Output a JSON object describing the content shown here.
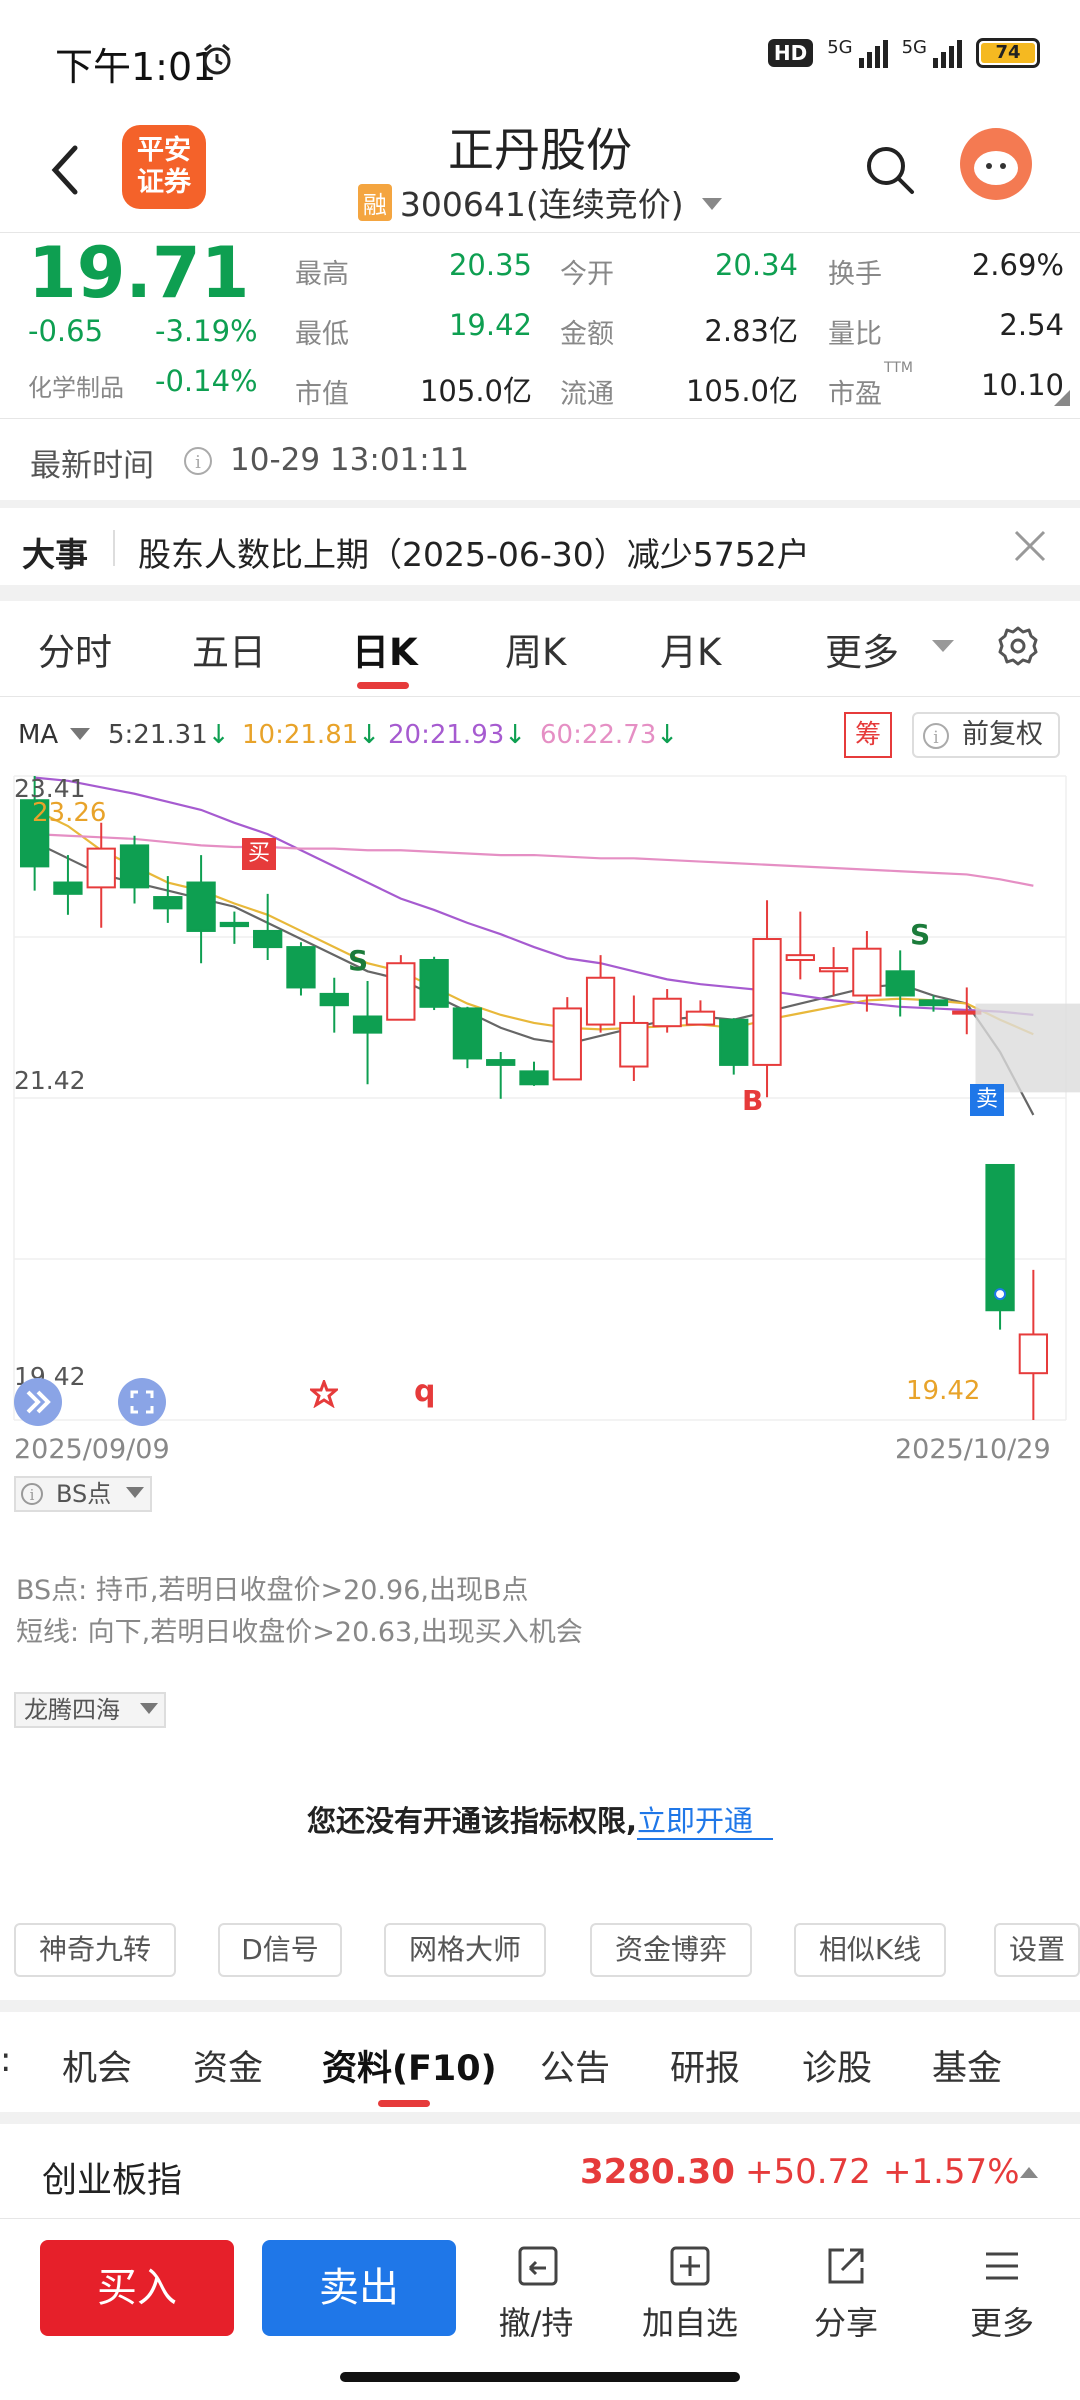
{
  "status_bar": {
    "time": "下午1:01",
    "hd": "HD",
    "net1": "5G",
    "net2": "5G",
    "battery": "74"
  },
  "header": {
    "app_logo": "平安\n证券",
    "stock_name": "正丹股份",
    "margin_badge": "融",
    "stock_code": "300641",
    "trade_mode": "(连续竞价)"
  },
  "quote": {
    "price": "19.71",
    "change": "-0.65",
    "change_pct": "-3.19%",
    "sector_label": "化学制品",
    "sector_pct": "-0.14%",
    "high_label": "最高",
    "high": "20.35",
    "open_label": "今开",
    "open": "20.34",
    "turnover_label": "换手",
    "turnover": "2.69%",
    "low_label": "最低",
    "low": "19.42",
    "amount_label": "金额",
    "amount": "2.83亿",
    "vol_ratio_label": "量比",
    "vol_ratio": "2.54",
    "mcap_label": "市值",
    "mcap": "105.0亿",
    "float_label": "流通",
    "float": "105.0亿",
    "pe_label": "市盈",
    "pe_ttm": "TTM",
    "pe": "10.10"
  },
  "update": {
    "label": "最新时间",
    "time": "10-29 13:01:11"
  },
  "event": {
    "tag": "大事",
    "text": "股东人数比上期（2025-06-30）减少5752户"
  },
  "period_tabs": [
    "分时",
    "五日",
    "日K",
    "周K",
    "月K",
    "更多"
  ],
  "active_tab": "日K",
  "ma": {
    "label": "MA",
    "ma5": "5:21.31",
    "ma10": "10:21.81",
    "ma20": "20:21.93",
    "ma60": "60:22.73",
    "chip_label": "筹",
    "adjust_label": "前复权"
  },
  "chart_data": {
    "type": "candlestick",
    "y_ticks": [
      "23.41",
      "21.42",
      "19.42"
    ],
    "x_start": "2025/09/09",
    "x_end": "2025/10/29",
    "high_label": "23.26",
    "low_label": "19.42",
    "markers": {
      "buy": "买",
      "sell": "卖",
      "b": "B",
      "s": "S",
      "q": "q"
    },
    "candles": [
      {
        "o": 23.26,
        "c": 22.85,
        "h": 23.41,
        "l": 22.7
      },
      {
        "o": 22.75,
        "c": 22.68,
        "h": 22.92,
        "l": 22.55
      },
      {
        "o": 22.72,
        "c": 22.96,
        "h": 23.12,
        "l": 22.47
      },
      {
        "o": 22.98,
        "c": 22.72,
        "h": 23.04,
        "l": 22.62
      },
      {
        "o": 22.66,
        "c": 22.59,
        "h": 22.79,
        "l": 22.5
      },
      {
        "o": 22.75,
        "c": 22.45,
        "h": 22.92,
        "l": 22.25
      },
      {
        "o": 22.5,
        "c": 22.48,
        "h": 22.57,
        "l": 22.37
      },
      {
        "o": 22.45,
        "c": 22.35,
        "h": 22.68,
        "l": 22.27
      },
      {
        "o": 22.35,
        "c": 22.1,
        "h": 22.38,
        "l": 22.05
      },
      {
        "o": 22.06,
        "c": 21.99,
        "h": 22.16,
        "l": 21.82
      },
      {
        "o": 21.92,
        "c": 21.82,
        "h": 22.14,
        "l": 21.5
      },
      {
        "o": 21.9,
        "c": 22.25,
        "h": 22.3,
        "l": 21.9
      },
      {
        "o": 22.27,
        "c": 21.98,
        "h": 22.29,
        "l": 21.96
      },
      {
        "o": 21.97,
        "c": 21.66,
        "h": 21.98,
        "l": 21.6
      },
      {
        "o": 21.65,
        "c": 21.62,
        "h": 21.7,
        "l": 21.41
      },
      {
        "o": 21.58,
        "c": 21.5,
        "h": 21.64,
        "l": 21.49
      },
      {
        "o": 21.53,
        "c": 21.97,
        "h": 22.04,
        "l": 21.53
      },
      {
        "o": 21.87,
        "c": 22.16,
        "h": 22.3,
        "l": 21.82
      },
      {
        "o": 21.61,
        "c": 21.88,
        "h": 22.05,
        "l": 21.52
      },
      {
        "o": 21.86,
        "c": 22.03,
        "h": 22.09,
        "l": 21.82
      },
      {
        "o": 21.87,
        "c": 21.95,
        "h": 22.02,
        "l": 21.87
      },
      {
        "o": 21.9,
        "c": 21.62,
        "h": 21.91,
        "l": 21.56
      },
      {
        "o": 21.62,
        "c": 22.4,
        "h": 22.64,
        "l": 21.42
      },
      {
        "o": 22.27,
        "c": 22.3,
        "h": 22.57,
        "l": 22.15
      },
      {
        "o": 22.2,
        "c": 22.22,
        "h": 22.35,
        "l": 22.05
      },
      {
        "o": 22.05,
        "c": 22.34,
        "h": 22.45,
        "l": 21.95
      },
      {
        "o": 22.2,
        "c": 22.05,
        "h": 22.33,
        "l": 21.92
      },
      {
        "o": 22.02,
        "c": 21.99,
        "h": 22.05,
        "l": 21.95
      },
      {
        "o": 21.95,
        "c": 21.95,
        "h": 22.1,
        "l": 21.81
      },
      {
        "o": 21.0,
        "c": 20.1,
        "h": 21.0,
        "l": 19.98
      },
      {
        "o": 19.71,
        "c": 19.95,
        "h": 19.42,
        "l": 20.35
      }
    ],
    "series": [
      {
        "key": "ma5",
        "color": "#666666",
        "values": [
          23.0,
          22.9,
          22.8,
          22.75,
          22.7,
          22.65,
          22.6,
          22.5,
          22.4,
          22.3,
          22.2,
          22.15,
          22.05,
          21.95,
          21.85,
          21.78,
          21.75,
          21.8,
          21.85,
          21.9,
          21.92,
          21.9,
          21.95,
          22.0,
          22.05,
          22.1,
          22.12,
          22.05,
          22.0,
          21.7,
          21.31
        ]
      },
      {
        "key": "ma10",
        "color": "#e8b83a",
        "values": [
          23.2,
          23.1,
          22.95,
          22.85,
          22.75,
          22.7,
          22.62,
          22.55,
          22.45,
          22.35,
          22.25,
          22.2,
          22.1,
          22.0,
          21.93,
          21.88,
          21.85,
          21.84,
          21.85,
          21.86,
          21.87,
          21.85,
          21.9,
          21.94,
          21.98,
          22.02,
          22.03,
          22.02,
          22.0,
          21.9,
          21.81
        ]
      },
      {
        "key": "ma20",
        "color": "#a65bd0",
        "values": [
          23.4,
          23.38,
          23.34,
          23.3,
          23.25,
          23.2,
          23.12,
          23.05,
          22.95,
          22.85,
          22.75,
          22.65,
          22.58,
          22.5,
          22.43,
          22.35,
          22.28,
          22.25,
          22.2,
          22.15,
          22.12,
          22.1,
          22.08,
          22.05,
          22.02,
          22.0,
          21.98,
          21.97,
          21.96,
          21.95,
          21.93
        ]
      },
      {
        "key": "ma60",
        "color": "#e58fc4",
        "values": [
          23.05,
          23.04,
          23.03,
          23.02,
          23.0,
          22.98,
          22.97,
          22.97,
          22.96,
          22.96,
          22.95,
          22.95,
          22.94,
          22.93,
          22.92,
          22.92,
          22.91,
          22.9,
          22.9,
          22.89,
          22.88,
          22.87,
          22.86,
          22.85,
          22.84,
          22.83,
          22.82,
          22.81,
          22.8,
          22.77,
          22.73
        ]
      }
    ]
  },
  "indicator1": {
    "label": "BS点",
    "line1": "BS点: 持币,若明日收盘价>20.96,出现B点",
    "line2": "短线: 向下,若明日收盘价>20.63,出现买入机会"
  },
  "indicator2": {
    "label": "龙腾四海",
    "notice": "您还没有开通该指标权限,",
    "link": "立即开通"
  },
  "tool_buttons": [
    "神奇九转",
    "D信号",
    "网格大师",
    "资金博弈",
    "相似K线",
    "设置"
  ],
  "info_tabs": [
    "机会",
    "资金",
    "资料(F10)",
    "公告",
    "研报",
    "诊股",
    "基金"
  ],
  "active_info_tab": "资料(F10)",
  "index_bar": {
    "name": "创业板指",
    "value": "3280.30",
    "change": "+50.72",
    "pct": "+1.57%"
  },
  "bottom_nav": {
    "buy": "买入",
    "sell": "卖出",
    "cancel": "撤/持",
    "watch": "加自选",
    "share": "分享",
    "more": "更多"
  },
  "colors": {
    "up": "#e63b3b",
    "down": "#0e9f51",
    "buy_btn": "#e6202a",
    "sell_btn": "#1f77e8",
    "link": "#1f77e8"
  }
}
